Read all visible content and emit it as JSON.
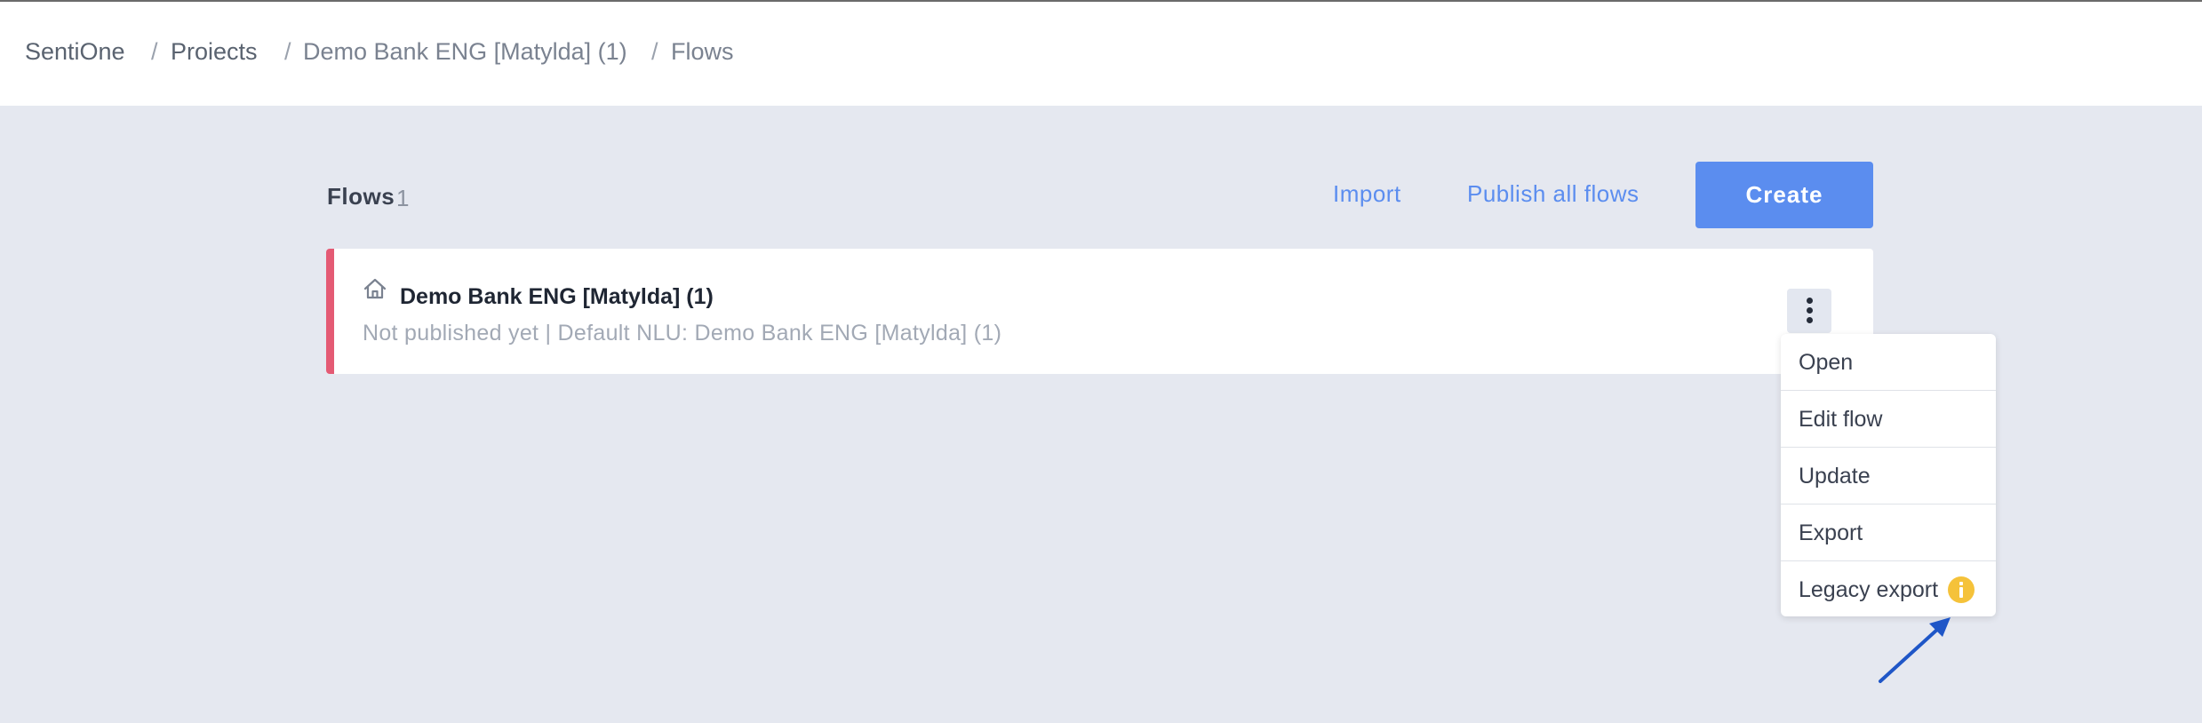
{
  "breadcrumb": {
    "items": [
      "SentiOne",
      "Proiects",
      "Demo Bank ENG [Matylda] (1)",
      "Flows"
    ],
    "separator": "/"
  },
  "flows": {
    "title": "Flows",
    "count": "1",
    "import_label": "Import",
    "publish_all_label": "Publish all flows",
    "create_label": "Create"
  },
  "flow": {
    "name": "Demo Bank ENG [Matylda] (1)",
    "meta": "Not published yet | Default NLU: Demo Bank ENG [Matylda] (1)",
    "icon": "home-icon"
  },
  "menu": {
    "items": [
      "Open",
      "Edit flow",
      "Update",
      "Export",
      "Legacy export"
    ],
    "legacy_icon": "info-icon"
  },
  "colors": {
    "accent": "#5b8def",
    "flow_status": "#e45a74",
    "info": "#f5c23a",
    "annotation_arrow": "#1f56c7"
  }
}
